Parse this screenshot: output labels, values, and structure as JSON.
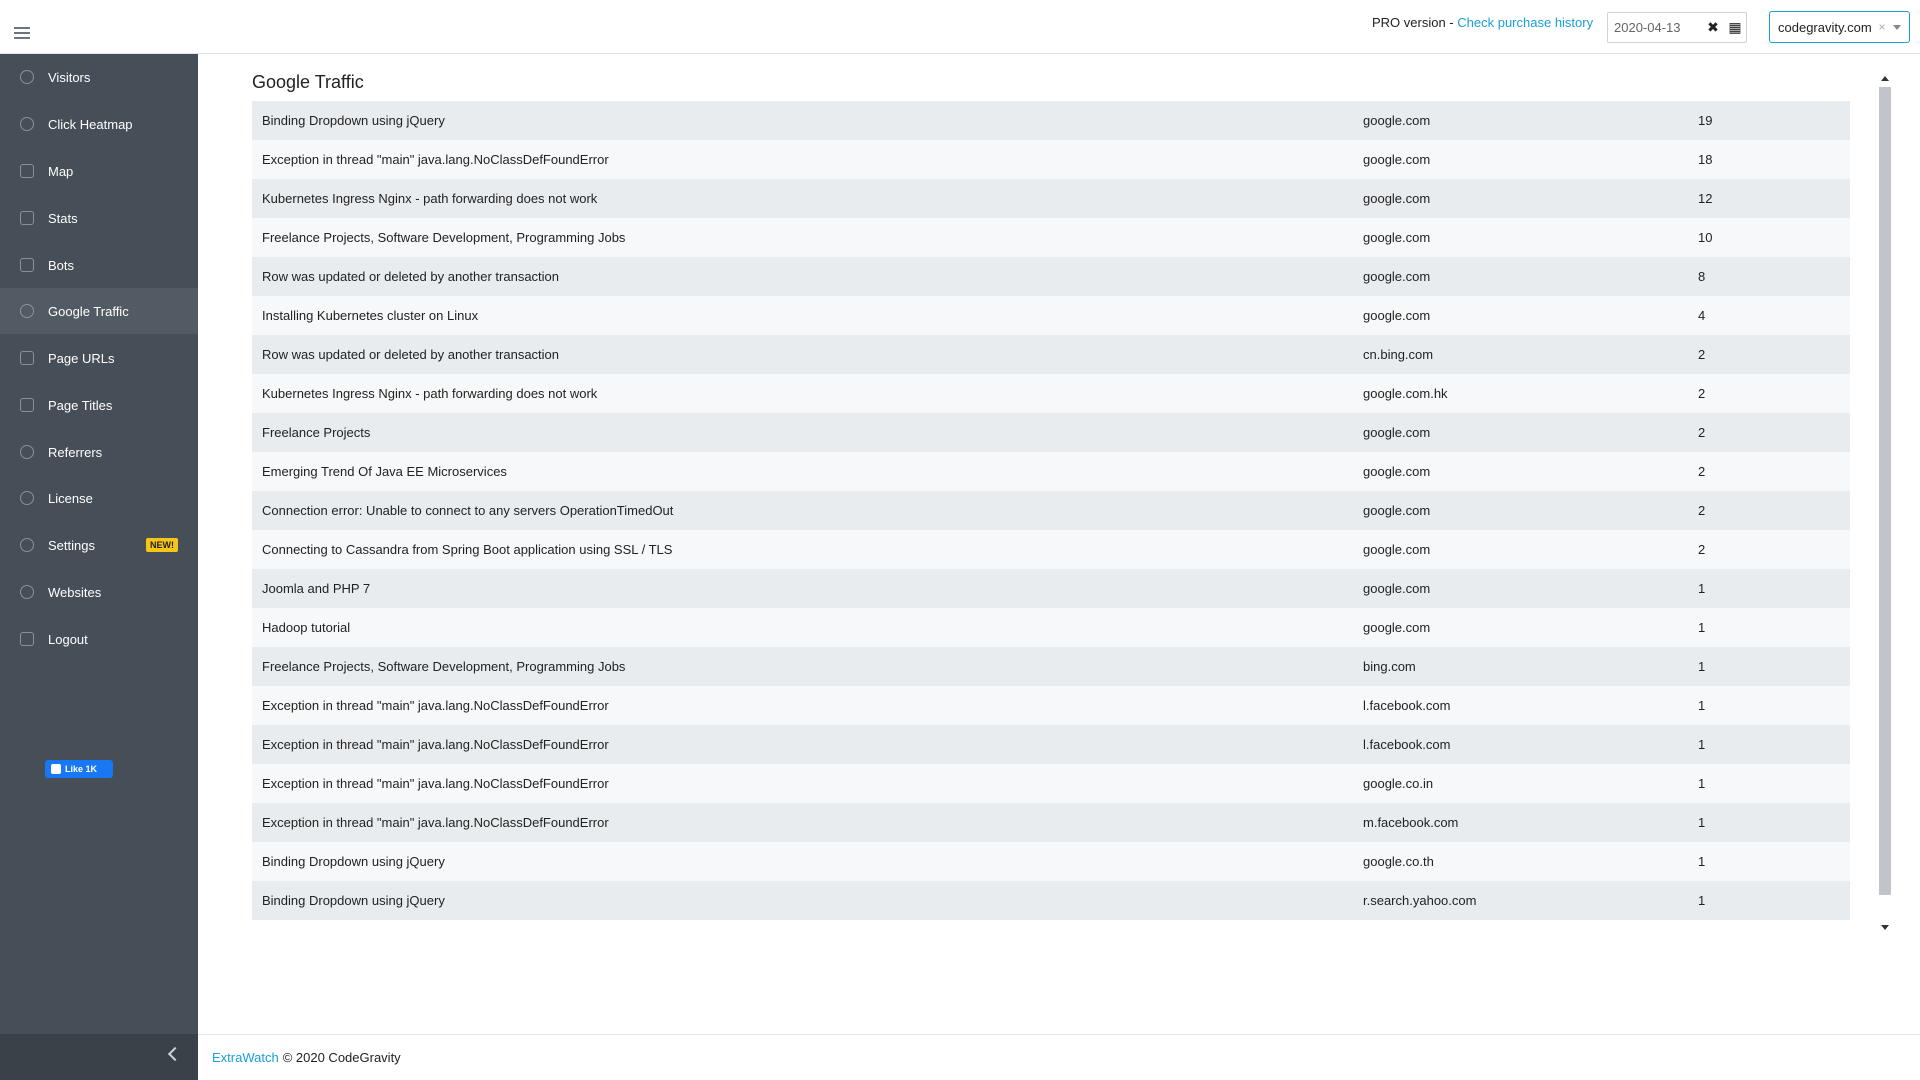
{
  "header": {
    "pro_text": "PRO version -",
    "purchase_link": "Check purchase history",
    "date_value": "2020-04-13",
    "site_value": "codegravity.com"
  },
  "sidebar": {
    "items": [
      {
        "label": "Visitors",
        "icon": "user-icon"
      },
      {
        "label": "Click Heatmap",
        "icon": "fire-icon"
      },
      {
        "label": "Map",
        "icon": "map-icon"
      },
      {
        "label": "Stats",
        "icon": "chart-line-icon"
      },
      {
        "label": "Bots",
        "icon": "bell-icon"
      },
      {
        "label": "Google Traffic",
        "icon": "search-icon"
      },
      {
        "label": "Page URLs",
        "icon": "file-icon"
      },
      {
        "label": "Page Titles",
        "icon": "list-icon"
      },
      {
        "label": "Referrers",
        "icon": "arrow-circle-icon"
      },
      {
        "label": "License",
        "icon": "badge-icon"
      },
      {
        "label": "Settings",
        "icon": "gear-icon"
      },
      {
        "label": "Websites",
        "icon": "globe-icon"
      },
      {
        "label": "Logout",
        "icon": "logout-icon"
      }
    ],
    "new_badge": "NEW!",
    "fb_like": "Like 1K"
  },
  "main": {
    "title": "Google Traffic",
    "rows": [
      {
        "title": "Binding Dropdown using jQuery",
        "referrer": "google.com",
        "count": "19"
      },
      {
        "title": "Exception in thread \"main\" java.lang.NoClassDefFoundError",
        "referrer": "google.com",
        "count": "18"
      },
      {
        "title": "Kubernetes Ingress Nginx - path forwarding does not work",
        "referrer": "google.com",
        "count": "12"
      },
      {
        "title": "Freelance Projects, Software Development, Programming Jobs",
        "referrer": "google.com",
        "count": "10"
      },
      {
        "title": "Row was updated or deleted by another transaction",
        "referrer": "google.com",
        "count": "8"
      },
      {
        "title": "Installing Kubernetes cluster on Linux",
        "referrer": "google.com",
        "count": "4"
      },
      {
        "title": "Row was updated or deleted by another transaction",
        "referrer": "cn.bing.com",
        "count": "2"
      },
      {
        "title": "Kubernetes Ingress Nginx - path forwarding does not work",
        "referrer": "google.com.hk",
        "count": "2"
      },
      {
        "title": "Freelance Projects",
        "referrer": "google.com",
        "count": "2"
      },
      {
        "title": "Emerging Trend Of Java EE Microservices",
        "referrer": "google.com",
        "count": "2"
      },
      {
        "title": "Connection error: Unable to connect to any servers OperationTimedOut",
        "referrer": "google.com",
        "count": "2"
      },
      {
        "title": "Connecting to Cassandra from Spring Boot application using SSL / TLS",
        "referrer": "google.com",
        "count": "2"
      },
      {
        "title": "Joomla and PHP 7",
        "referrer": "google.com",
        "count": "1"
      },
      {
        "title": "Hadoop tutorial",
        "referrer": "google.com",
        "count": "1"
      },
      {
        "title": "Freelance Projects, Software Development, Programming Jobs",
        "referrer": "bing.com",
        "count": "1"
      },
      {
        "title": "Exception in thread \"main\" java.lang.NoClassDefFoundError",
        "referrer": "l.facebook.com",
        "count": "1"
      },
      {
        "title": "Exception in thread \"main\" java.lang.NoClassDefFoundError",
        "referrer": "l.facebook.com",
        "count": "1"
      },
      {
        "title": "Exception in thread \"main\" java.lang.NoClassDefFoundError",
        "referrer": "google.co.in",
        "count": "1"
      },
      {
        "title": "Exception in thread \"main\" java.lang.NoClassDefFoundError",
        "referrer": "m.facebook.com",
        "count": "1"
      },
      {
        "title": "Binding Dropdown using jQuery",
        "referrer": "google.co.th",
        "count": "1"
      },
      {
        "title": "Binding Dropdown using jQuery",
        "referrer": "r.search.yahoo.com",
        "count": "1"
      }
    ]
  },
  "footer": {
    "brand": "ExtraWatch",
    "copyright": "© 2020 CodeGravity"
  }
}
